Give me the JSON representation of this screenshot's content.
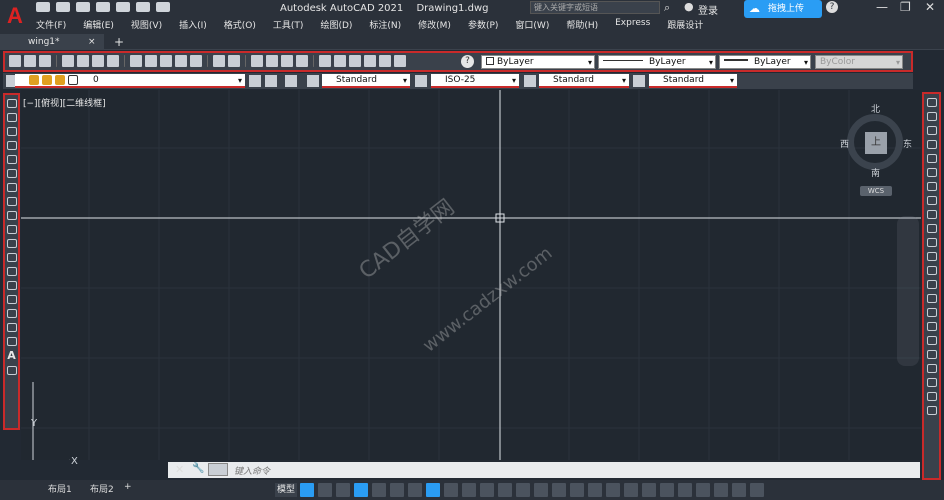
{
  "app": {
    "title": "Autodesk AutoCAD 2021",
    "file": "Drawing1.dwg",
    "search_placeholder": "键入关键字或短语",
    "login": "登录",
    "upload": "拖拽上传"
  },
  "menu": [
    "文件(F)",
    "编辑(E)",
    "视图(V)",
    "插入(I)",
    "格式(O)",
    "工具(T)",
    "绘图(D)",
    "标注(N)",
    "修改(M)",
    "参数(P)",
    "窗口(W)",
    "帮助(H)",
    "Express",
    "跟展设计"
  ],
  "tabs": {
    "doc": "wing1*",
    "close": "×",
    "new": "+"
  },
  "properties": {
    "color": "ByLayer",
    "linetype": "ByLayer",
    "lineweight": "ByLayer",
    "plotstyle": "ByColor",
    "help": "?"
  },
  "styles": {
    "layer": "0",
    "text_style": "Standard",
    "dim_style": "ISO-25",
    "table_style": "Standard",
    "mleader_style": "Standard"
  },
  "canvas": {
    "viewport_label": "[−][俯视][二维线框]",
    "viewcube": {
      "north": "北",
      "south": "南",
      "west": "西",
      "east": "东",
      "top": "上",
      "wcs": "WCS"
    },
    "ucs_y": "Y",
    "ucs_x": "X",
    "watermark1": "CAD自学网",
    "watermark2": "www.cadzxw.com"
  },
  "command": {
    "placeholder": "键入命令"
  },
  "status": {
    "layout1": "布局1",
    "layout2": "布局2",
    "model": "模型"
  },
  "colors": {
    "accent_red": "#c92a2a",
    "accent_blue": "#2a9df4",
    "canvas_bg": "#212830"
  }
}
